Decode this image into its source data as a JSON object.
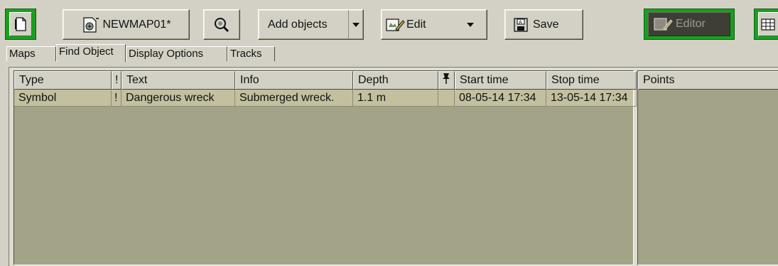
{
  "toolbar": {
    "map_name": "NEWMAP01*",
    "add_objects_label": "Add objects",
    "edit_label": "Edit",
    "save_label": "Save",
    "editor_label": "Editor",
    "accent_color": "#19a01e"
  },
  "tabs": [
    {
      "label": "Maps"
    },
    {
      "label": "Find Object"
    },
    {
      "label": "Display Options"
    },
    {
      "label": "Tracks"
    }
  ],
  "active_tab": "Find Object",
  "table": {
    "columns": [
      "Type",
      "!",
      "Text",
      "Info",
      "Depth",
      "pin-icon",
      "Start time",
      "Stop time"
    ],
    "rows": [
      {
        "type": "Symbol",
        "flag": "!",
        "text": "Dangerous wreck",
        "info": "Submerged wreck.",
        "depth": "1.1 m",
        "pin": "",
        "start_time": "08-05-14 17:34",
        "stop_time": "13-05-14 17:34"
      }
    ]
  },
  "points": {
    "header": "Points"
  },
  "colors": {
    "background": "#d3d1c5",
    "table_area": "#a3a387",
    "row_selected": "#c2c09e"
  }
}
